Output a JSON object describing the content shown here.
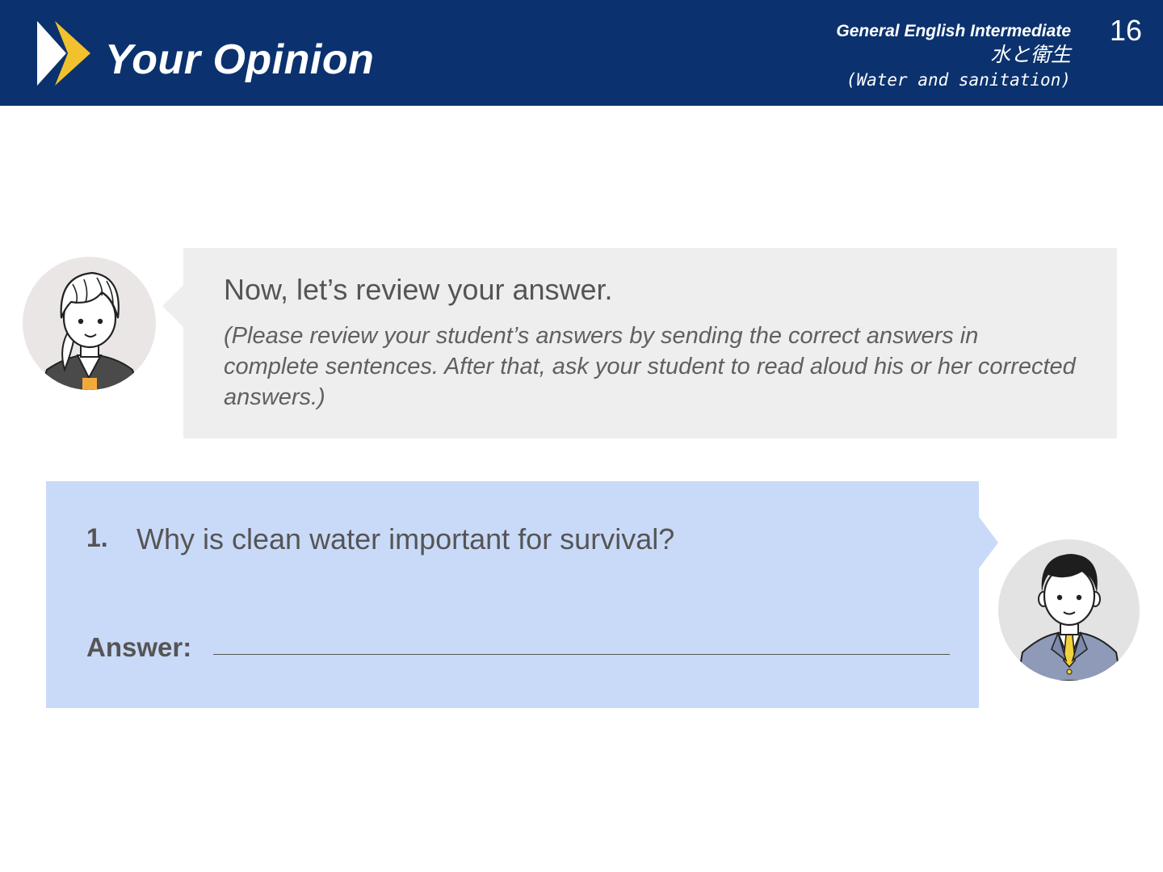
{
  "header": {
    "title": "Your Opinion",
    "course_name": "General English Intermediate",
    "topic_jp": "水と衛生",
    "topic_en": "(Water and sanitation)",
    "page_number": "16",
    "logo_icon": "double-chevron-right-icon",
    "background_color": "#0b326e",
    "accent_color": "#f2c12e"
  },
  "teacher_bubble": {
    "heading": "Now, let’s review your answer.",
    "note": "(Please review your student’s answers by sending the correct answers in complete sentences. After that, ask your student to read aloud his or her corrected answers.)",
    "avatar_icon": "teacher-avatar-icon",
    "background_color": "#eeeeee"
  },
  "question": {
    "number": "1.",
    "text": "Why is clean water important for survival?",
    "answer_label": "Answer:",
    "avatar_icon": "student-avatar-icon",
    "background_color": "#c9daf8"
  }
}
